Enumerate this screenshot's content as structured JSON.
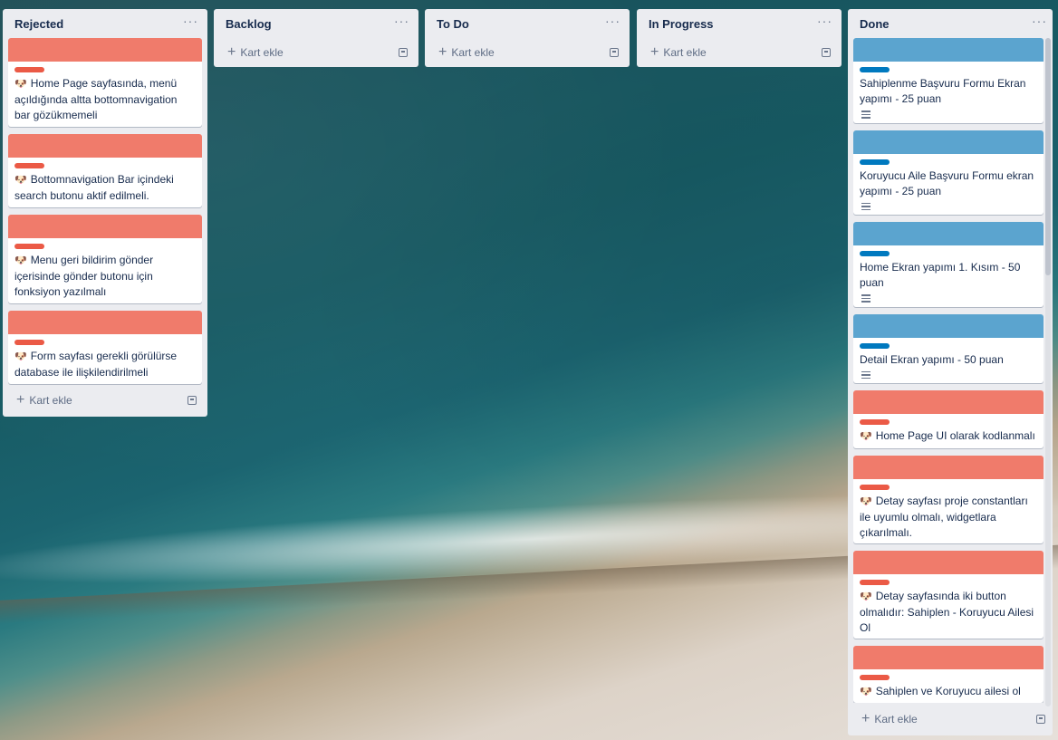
{
  "colors": {
    "red": "#f07b6b",
    "red_label": "#eb5a46",
    "blue": "#5ba4cf",
    "blue_label": "#0079bf"
  },
  "add_card_label": "Kart ekle",
  "menu_glyph": "···",
  "lists": {
    "rejected": {
      "title": "Rejected",
      "cards": [
        {
          "text": "Home Page sayfasında, menü açıldığında altta bottomnavigation bar gözükmemeli"
        },
        {
          "text": "Bottomnavigation Bar içindeki search butonu aktif edilmeli."
        },
        {
          "text": "Menu geri bildirim gönder içerisinde gönder butonu için fonksiyon yazılmalı"
        },
        {
          "text": "Form sayfası gerekli görülürse database ile ilişkilendirilmeli"
        }
      ]
    },
    "backlog": {
      "title": "Backlog"
    },
    "todo": {
      "title": "To Do"
    },
    "inprogress": {
      "title": "In Progress"
    },
    "done": {
      "title": "Done",
      "cards": [
        {
          "text": "Sahiplenme Başvuru Formu Ekran yapımı - 25 puan"
        },
        {
          "text": "Koruyucu Aile Başvuru Formu ekran yapımı - 25 puan"
        },
        {
          "text": "Home Ekran yapımı 1. Kısım - 50 puan"
        },
        {
          "text": "Detail Ekran yapımı - 50 puan"
        },
        {
          "text": "Home Page UI olarak kodlanmalı"
        },
        {
          "text": "Detay sayfası proje constantları ile uyumlu olmalı, widgetlara çıkarılmalı."
        },
        {
          "text": "Detay sayfasında iki button olmalıdır: Sahiplen - Koruyucu Ailesi Ol"
        },
        {
          "text": "Sahiplen ve Koruyucu ailesi ol"
        }
      ]
    }
  }
}
